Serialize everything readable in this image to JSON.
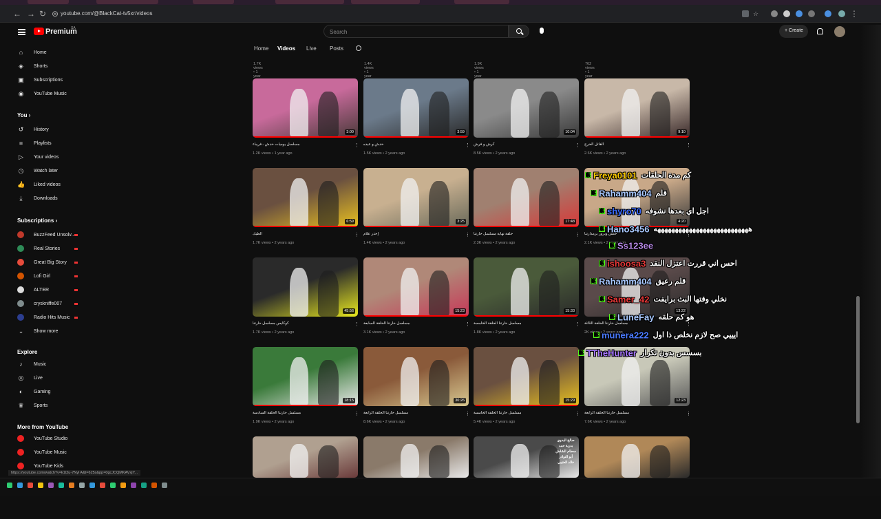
{
  "browser": {
    "url": "youtube.com/@BlackCat-tv5xr/videos",
    "status_url": "https://youtube.com/watch?v=k1t2u-7Nyl A&t=625s&pp=0gcJCQMKAVxjY..."
  },
  "header": {
    "logo_text": "Premium",
    "logo_sup": "SA",
    "search_placeholder": "Search",
    "create_label": "+ Create"
  },
  "sidebar": {
    "main": [
      {
        "label": "Home",
        "icon": "home-icon",
        "glyph": "⌂"
      },
      {
        "label": "Shorts",
        "icon": "shorts-icon",
        "glyph": "◈"
      },
      {
        "label": "Subscriptions",
        "icon": "subscriptions-icon",
        "glyph": "▣"
      },
      {
        "label": "YouTube Music",
        "icon": "music-icon",
        "glyph": "◉"
      }
    ],
    "you_heading": "You  ›",
    "you": [
      {
        "label": "History",
        "icon": "history-icon",
        "glyph": "↺"
      },
      {
        "label": "Playlists",
        "icon": "playlists-icon",
        "glyph": "≡"
      },
      {
        "label": "Your videos",
        "icon": "your-videos-icon",
        "glyph": "▷"
      },
      {
        "label": "Watch later",
        "icon": "watch-later-icon",
        "glyph": "◷"
      },
      {
        "label": "Liked videos",
        "icon": "liked-icon",
        "glyph": "👍"
      },
      {
        "label": "Downloads",
        "icon": "download-icon",
        "glyph": "⤓"
      }
    ],
    "subs_heading": "Subscriptions  ›",
    "subscriptions": [
      {
        "label": "BuzzFeed Unsolv...",
        "color": "#c0392b"
      },
      {
        "label": "Real Stories",
        "color": "#2e8b57"
      },
      {
        "label": "Great Big Story",
        "color": "#e74c3c"
      },
      {
        "label": "Lofi Girl",
        "color": "#d35400"
      },
      {
        "label": "ALTER",
        "color": "#dddddd"
      },
      {
        "label": "cryskniffe007",
        "color": "#7f8c8d"
      },
      {
        "label": "Radio Hits Music",
        "color": "#2c3e90"
      }
    ],
    "show_more": "Show more",
    "explore_heading": "Explore",
    "explore": [
      {
        "label": "Music",
        "icon": "music-note-icon",
        "glyph": "♪"
      },
      {
        "label": "Live",
        "icon": "live-icon",
        "glyph": "◎"
      },
      {
        "label": "Gaming",
        "icon": "gaming-icon",
        "glyph": "◐"
      },
      {
        "label": "Sports",
        "icon": "sports-icon",
        "glyph": "♛"
      }
    ],
    "more_heading": "More from YouTube",
    "more": [
      {
        "label": "YouTube Studio"
      },
      {
        "label": "YouTube Music"
      },
      {
        "label": "YouTube Kids"
      }
    ]
  },
  "tabs": [
    "Home",
    "Videos",
    "Live",
    "Posts"
  ],
  "top_row_meta": [
    "1.7K views • 1 year ago",
    "1.4K views • 1 year ago",
    "1.9K views • 1 year ago",
    "762 views • 1 year ago"
  ],
  "videos": [
    {
      "title": "مسلسل يوميات حدش ـ فريباء",
      "meta": "1.2K views • 1 year ago",
      "duration": "3:00",
      "c1": "#c86a9b",
      "c2": "#4a3a3a"
    },
    {
      "title": "حدش و عيده",
      "meta": "1.5K views • 2 years ago",
      "duration": "3:59",
      "c1": "#6b7a8a",
      "c2": "#2a2a2a"
    },
    {
      "title": "كرش و فرش",
      "meta": "8.5K views • 2 years ago",
      "duration": "10:04",
      "c1": "#8a8a8a",
      "c2": "#3a3a3a"
    },
    {
      "title": "القاتل الحرج",
      "meta": "2.6K views • 2 years ago",
      "duration": "9:10",
      "c1": "#c8b8a8",
      "c2": "#3a2a2a"
    },
    {
      "title": "الطيك",
      "meta": "1.7K views • 2 years ago",
      "duration": "6:59",
      "c1": "#6a5040",
      "c2": "#e8c020"
    },
    {
      "title": "إحذر علام",
      "meta": "1.4K views • 2 years ago",
      "duration": "3:25",
      "c1": "#c8b090",
      "c2": "#6a6a5a"
    },
    {
      "title": "حلقة نهاية مسلسل حارتنا",
      "meta": "2.3K views • 2 years ago",
      "duration": "17:48",
      "c1": "#a08070",
      "c2": "#d83838"
    },
    {
      "title": "حلش وبزور برمدارتنا",
      "meta": "2.1K views • 2 years ago",
      "duration": "4:20",
      "c1": "#c8a888",
      "c2": "#3a3a3a"
    },
    {
      "title": "كوكايس مسلسل حارتنا",
      "meta": "1.7K views • 2 years ago",
      "duration": "45:56",
      "c1": "#2a2a2a",
      "c2": "#e8e820"
    },
    {
      "title": "مسلسل حارتنا الحلقة السابعة",
      "meta": "3.1K views • 2 years ago",
      "duration": "15:23",
      "c1": "#b08878",
      "c2": "#c83858"
    },
    {
      "title": "مسلسل حارتنا الحلقة الخامسة",
      "meta": "1.8K views • 2 years ago",
      "duration": "15:33",
      "c1": "#4a5a3a",
      "c2": "#2a2a2a"
    },
    {
      "title": "مسلسل حارتنا الحلقة الثالثة",
      "meta": "2K views • 2 years ago",
      "duration": "13:22",
      "c1": "#5a4a4a",
      "c2": "#2a2a2a"
    },
    {
      "title": "مسلسل حارتنا الحلقة السادسة",
      "meta": "1.9K views • 2 years ago",
      "duration": "18:15",
      "c1": "#3a7a3a",
      "c2": "#e8e8e8"
    },
    {
      "title": "مسلسل حارتنا الحلقة الرابعة",
      "meta": "8.6K views • 2 years ago",
      "duration": "30:26",
      "c1": "#8a5a3a",
      "c2": "#d8c890"
    },
    {
      "title": "مسلسل حارتنا الحلقة الخامسة",
      "meta": "5.4K views • 2 years ago",
      "duration": "15:29",
      "c1": "#6a5040",
      "c2": "#e8c020"
    },
    {
      "title": "مسلسل حارتنا الحلقة الرابعة",
      "meta": "7.6K views • 2 years ago",
      "duration": "12:23",
      "c1": "#c8c8b8",
      "c2": "#5a5a5a"
    },
    {
      "title": "",
      "meta": "",
      "duration": "",
      "c1": "#b0a090",
      "c2": "#6a3a3a"
    },
    {
      "title": "",
      "meta": "",
      "duration": "",
      "c1": "#8a7a6a",
      "c2": "#e8e8e8"
    },
    {
      "title": "",
      "meta": "",
      "duration": "",
      "c1": "#4a4a4a",
      "c2": "#e8e8e8"
    },
    {
      "title": "",
      "meta": "",
      "duration": "",
      "c1": "#b08858",
      "c2": "#2a2a2a"
    }
  ],
  "thumb_text_overlay": "صالح البدوي\nبدرية حمد\nسطام الشلش\nأبو النوادر\nخالد العتيبي",
  "chat": [
    {
      "user": "Freya0101",
      "user_color": "#ffcc00",
      "msg": "كم مدة الحلقات"
    },
    {
      "user": "Rahamm404",
      "user_color": "#a8c8ff",
      "msg": "قلم"
    },
    {
      "user": "shyro70",
      "user_color": "#3a6aff",
      "msg": "اجل اي بعدها نشوفه"
    },
    {
      "user": "Hano3456",
      "user_color": "#a8c8ff",
      "msg": "هههههههههههههههههههههههههههه"
    },
    {
      "user": "Ss123ee",
      "user_color": "#b88ae8",
      "msg": ""
    },
    {
      "user": "ishoosa3",
      "user_color": "#e83838",
      "msg": "احس اني قررت اعتزل النقد"
    },
    {
      "user": "Rahamm404",
      "user_color": "#a8c8ff",
      "msg": "قلم رعيق"
    },
    {
      "user": "Samer_42",
      "user_color": "#e83838",
      "msg": "نخلي وقتها البث برايفت"
    },
    {
      "user": "LuneFay",
      "user_color": "#a8c8ff",
      "msg": "هو كم حلقه"
    },
    {
      "user": "munera222",
      "user_color": "#4a7aff",
      "msg": "ايييي صح لازم نخلص ذا اول"
    },
    {
      "user": "TTheHunter",
      "user_color": "#a878ff",
      "msg": "بسسس بدون تكرار"
    }
  ]
}
